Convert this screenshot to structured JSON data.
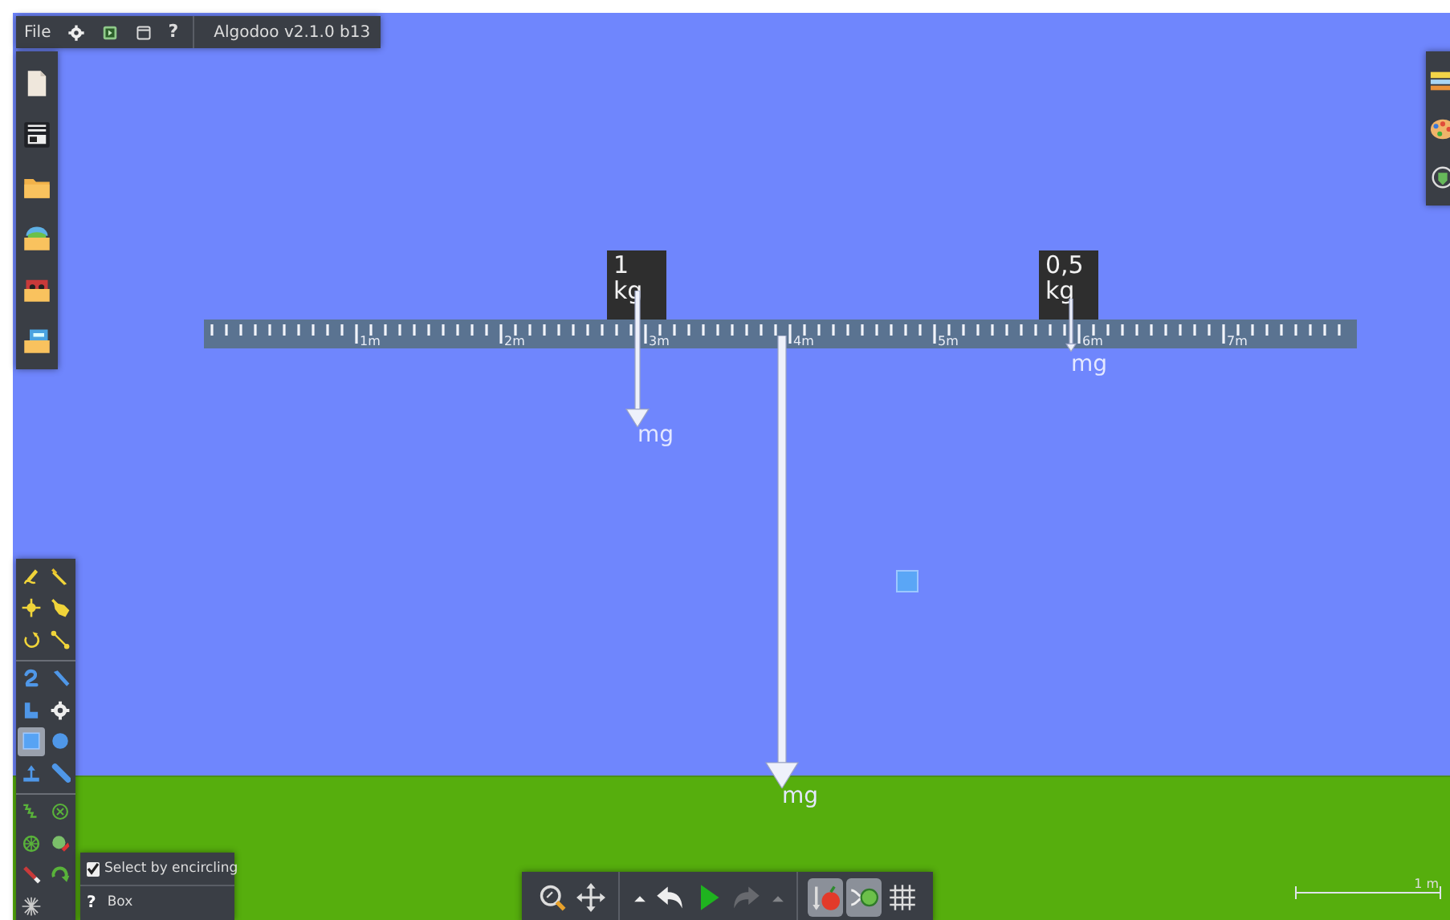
{
  "menu_bar": {
    "file": "File",
    "help": "?",
    "version": "Algodoo v2.1.0 b13"
  },
  "file_toolbar": [
    {
      "kind": "new"
    },
    {
      "kind": "save"
    },
    {
      "kind": "open"
    },
    {
      "kind": "scenes"
    },
    {
      "kind": "phunlets"
    },
    {
      "kind": "browse"
    }
  ],
  "right_toolbar": [
    {
      "kind": "layers"
    },
    {
      "kind": "palette"
    },
    {
      "kind": "visualize"
    }
  ],
  "ruler": {
    "labels": [
      "1m",
      "2m",
      "3m",
      "4m",
      "5m",
      "6m",
      "7m"
    ],
    "force_label": "mg"
  },
  "masses": [
    {
      "label": "1 kg",
      "force_label": "mg"
    },
    {
      "label": "0,5 kg",
      "force_label": "mg"
    }
  ],
  "tool_groups": [
    {
      "tools": [
        {
          "kind": "sketch",
          "selected": false
        },
        {
          "kind": "cut",
          "selected": false
        },
        {
          "kind": "move",
          "selected": false
        },
        {
          "kind": "drag",
          "selected": false
        },
        {
          "kind": "rotate",
          "selected": false
        },
        {
          "kind": "scale",
          "selected": false
        }
      ]
    },
    {
      "tools": [
        {
          "kind": "polygon",
          "selected": false
        },
        {
          "kind": "brush",
          "selected": false
        },
        {
          "kind": "plane_l",
          "selected": false
        },
        {
          "kind": "gear",
          "selected": false
        },
        {
          "kind": "box",
          "selected": true
        },
        {
          "kind": "circle",
          "selected": false
        },
        {
          "kind": "plane",
          "selected": false
        },
        {
          "kind": "chain",
          "selected": false
        }
      ]
    },
    {
      "tools": [
        {
          "kind": "spring",
          "selected": false
        },
        {
          "kind": "fixate",
          "selected": false
        },
        {
          "kind": "axle",
          "selected": false
        },
        {
          "kind": "tracer",
          "selected": false
        },
        {
          "kind": "laser",
          "selected": false
        },
        {
          "kind": "thruster",
          "selected": false
        },
        {
          "kind": "fracture",
          "selected": false
        }
      ]
    }
  ],
  "tool_options": {
    "checkbox_label": "Select by encircling",
    "checked": true,
    "help": "?",
    "tool_name": "Box"
  },
  "bottom_toolbar": [
    {
      "kind": "zoom",
      "on": false,
      "disabled": false
    },
    {
      "kind": "pan",
      "on": false,
      "disabled": false
    },
    {
      "kind": "more",
      "on": false,
      "disabled": false
    },
    {
      "kind": "undo",
      "on": false,
      "disabled": false
    },
    {
      "kind": "play",
      "on": false,
      "disabled": false
    },
    {
      "kind": "redo",
      "on": false,
      "disabled": true
    },
    {
      "kind": "more",
      "on": false,
      "disabled": true
    },
    {
      "kind": "gravity",
      "on": true,
      "disabled": false
    },
    {
      "kind": "air",
      "on": true,
      "disabled": false
    },
    {
      "kind": "grid",
      "on": false,
      "disabled": false
    }
  ],
  "scale_bar": {
    "label": "1 m"
  }
}
